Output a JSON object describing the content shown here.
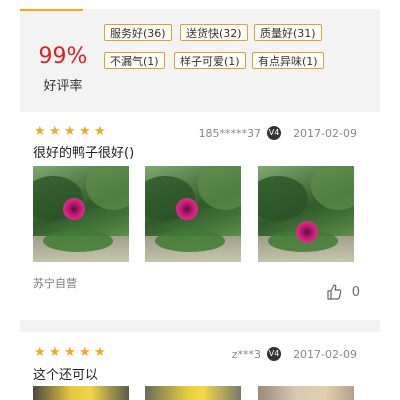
{
  "summary": {
    "rate_value": "99%",
    "rate_label": "好评率",
    "tags": [
      {
        "label": "服务好(36)"
      },
      {
        "label": "送货快(32)"
      },
      {
        "label": "质量好(31)"
      },
      {
        "label": "不漏气(1)"
      },
      {
        "label": "样子可爱(1)"
      },
      {
        "label": "有点异味(1)"
      }
    ],
    "accent_color": "#f5a623",
    "rate_color": "#e01f1f"
  },
  "reviews": [
    {
      "rating": 5,
      "user": "185*****37",
      "level": "V4",
      "date": "2017-02-09",
      "text": "很好的鸭子很好()",
      "seller": "苏宁自营",
      "likes": "0",
      "photos": [
        "flower-photo",
        "flower-photo",
        "flower-photo"
      ]
    },
    {
      "rating": 5,
      "user": "z***3",
      "level": "V4",
      "date": "2017-02-09",
      "text": "这个还可以",
      "photos": [
        "duck-photo",
        "duck-photo",
        "duck-photo"
      ]
    }
  ],
  "icons": {
    "star": "star-icon",
    "like": "thumbs-up-icon",
    "level": "vip-badge-icon"
  },
  "colors": {
    "star": "#f5a623",
    "tag_border": "#d9a13a"
  }
}
